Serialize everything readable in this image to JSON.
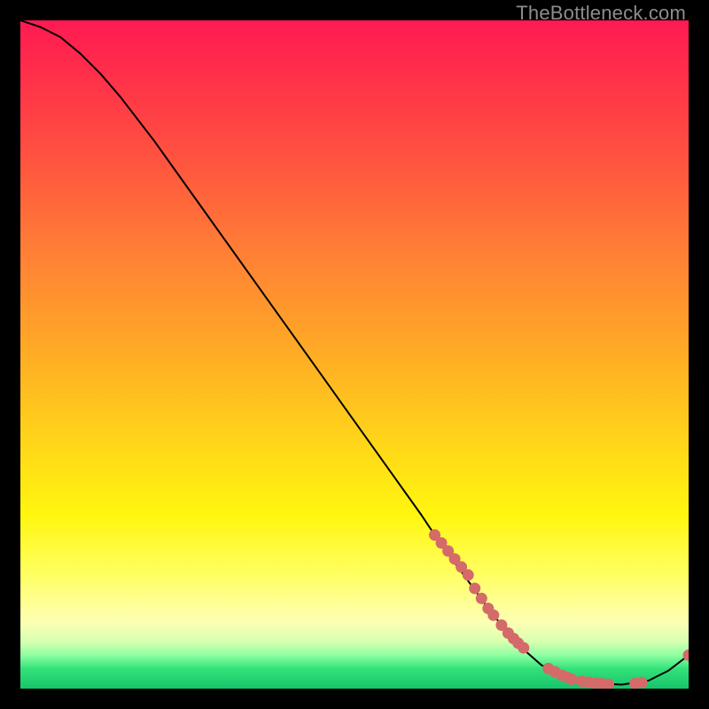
{
  "watermark": "TheBottleneck.com",
  "colors": {
    "gradient_top": "#ff1a52",
    "gradient_mid": "#ffd21a",
    "gradient_bottom": "#17c46a",
    "curve": "#000000",
    "marker": "#d46a6a",
    "page_bg": "#000000"
  },
  "chart_data": {
    "type": "line",
    "title": "",
    "xlabel": "",
    "ylabel": "",
    "xlim": [
      0,
      100
    ],
    "ylim": [
      0,
      100
    ],
    "grid": false,
    "legend": false,
    "x": [
      0,
      3,
      6,
      9,
      12,
      15,
      20,
      25,
      30,
      35,
      40,
      45,
      50,
      55,
      60,
      63,
      66,
      70,
      74,
      78,
      82,
      86,
      90,
      94,
      97,
      100
    ],
    "y": [
      100,
      99,
      97.5,
      95,
      92,
      88.5,
      82,
      75,
      68,
      61,
      54,
      47,
      40,
      33,
      26,
      21.5,
      17.5,
      12,
      7,
      3.5,
      1.5,
      0.8,
      0.6,
      1.2,
      2.7,
      5
    ],
    "note": "x,y are in percent of plot area (0..100). y=0 is bottom green band; y=100 is top red. Curve is a monotone descent with slight initial shoulder, then a valley around x≈88, then a small uptick at the far right.",
    "markers": {
      "comment": "Salmon dots along the lower-right portion of the curve. Two clusters plus sparse points up the slope and one at far right.",
      "x": [
        62,
        63,
        64,
        65,
        66,
        67,
        68,
        69,
        70,
        70.8,
        72,
        73,
        73.8,
        74.5,
        75.3,
        79,
        80,
        81,
        81.8,
        82.5,
        84,
        85,
        86,
        87,
        88,
        92,
        93,
        100
      ],
      "y": [
        23,
        21.8,
        20.6,
        19.4,
        18.2,
        17,
        15,
        13.5,
        12,
        11,
        9.5,
        8.3,
        7.5,
        6.8,
        6.1,
        3,
        2.5,
        2,
        1.7,
        1.4,
        1.1,
        0.95,
        0.85,
        0.75,
        0.65,
        0.8,
        0.9,
        5
      ]
    }
  }
}
